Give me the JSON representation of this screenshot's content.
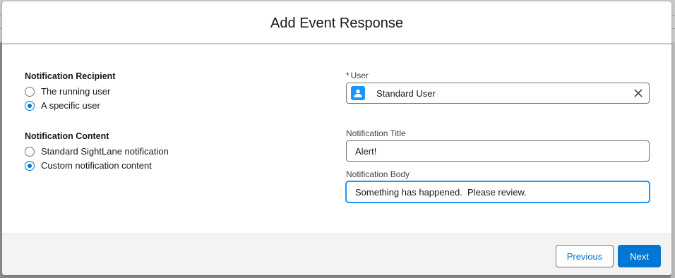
{
  "modal": {
    "title": "Add Event Response"
  },
  "recipient": {
    "section_label": "Notification Recipient",
    "options": [
      {
        "label": "The running user",
        "checked": false
      },
      {
        "label": "A specific user",
        "checked": true
      }
    ]
  },
  "content": {
    "section_label": "Notification Content",
    "options": [
      {
        "label": "Standard SightLane notification",
        "checked": false
      },
      {
        "label": "Custom notification content",
        "checked": true
      }
    ]
  },
  "fields": {
    "user": {
      "required_marker": "*",
      "label": "User",
      "value": "Standard User",
      "icon": "user-icon"
    },
    "title": {
      "label": "Notification Title",
      "value": "Alert!"
    },
    "body": {
      "label": "Notification Body",
      "value": "Something has happened.  Please review."
    }
  },
  "footer": {
    "previous_label": "Previous",
    "next_label": "Next"
  },
  "colors": {
    "brand": "#0176d3",
    "focus": "#1b96ff",
    "required": "#ba0517",
    "footer_bg": "#f3f3f3"
  }
}
